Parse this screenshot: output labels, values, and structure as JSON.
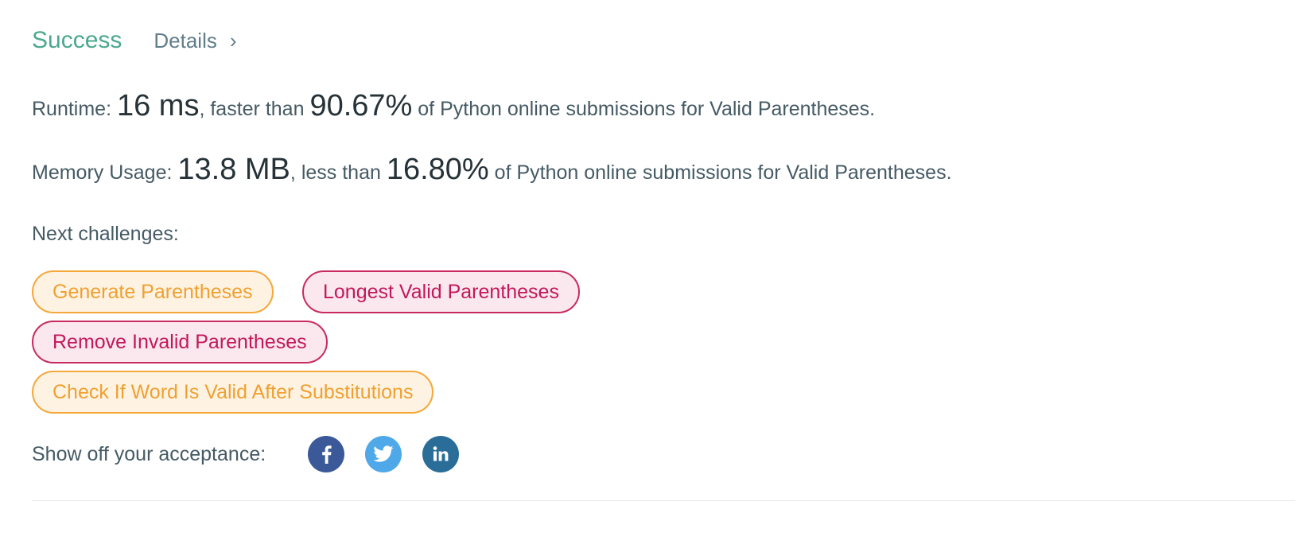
{
  "header": {
    "status": "Success",
    "details_label": "Details",
    "details_chevron": "›"
  },
  "runtime": {
    "label": "Runtime: ",
    "value": "16 ms",
    "mid": ", faster than ",
    "percent": "90.67%",
    "suffix": " of Python online submissions for Valid Parentheses."
  },
  "memory": {
    "label": "Memory Usage: ",
    "value": "13.8 MB",
    "mid": ", less than ",
    "percent": "16.80%",
    "suffix": " of Python online submissions for Valid Parentheses."
  },
  "next": {
    "label": "Next challenges:",
    "challenges": [
      {
        "title": "Generate Parentheses",
        "difficulty_color": "#f0a030"
      },
      {
        "title": "Longest Valid Parentheses",
        "difficulty_color": "#c2185b"
      },
      {
        "title": "Remove Invalid Parentheses",
        "difficulty_color": "#c2185b"
      },
      {
        "title": "Check If Word Is Valid After Substitutions",
        "difficulty_color": "#f0a030"
      }
    ]
  },
  "share": {
    "label": "Show off your acceptance:",
    "icons": [
      "facebook-icon",
      "twitter-icon",
      "linkedin-icon"
    ]
  },
  "colors": {
    "success": "#4ca890",
    "facebook": "#3b5998",
    "twitter": "#4fa9e8",
    "linkedin": "#2a6d98"
  }
}
